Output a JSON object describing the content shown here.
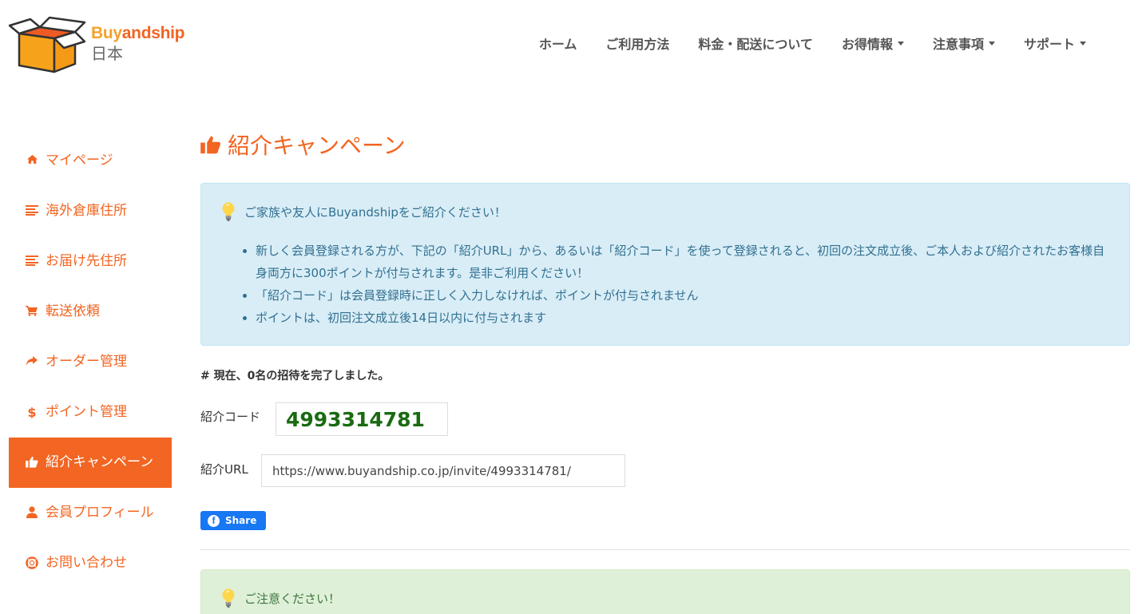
{
  "brand": {
    "name_part1": "Buy",
    "name_part2": "andship",
    "region": "日本",
    "accent_color": "#f26522"
  },
  "topnav": [
    {
      "label": "ホーム",
      "has_dropdown": false
    },
    {
      "label": "ご利用方法",
      "has_dropdown": false
    },
    {
      "label": "料金・配送について",
      "has_dropdown": false
    },
    {
      "label": "お得情報",
      "has_dropdown": true
    },
    {
      "label": "注意事項",
      "has_dropdown": true
    },
    {
      "label": "サポート",
      "has_dropdown": true
    }
  ],
  "sidebar": {
    "items": [
      {
        "label": "マイページ",
        "icon": "home-icon"
      },
      {
        "label": "海外倉庫住所",
        "icon": "list-icon"
      },
      {
        "label": "お届け先住所",
        "icon": "list-icon"
      },
      {
        "label": "転送依頼",
        "icon": "cart-icon"
      },
      {
        "label": "オーダー管理",
        "icon": "share-arrow-icon"
      },
      {
        "label": "ポイント管理",
        "icon": "dollar-icon"
      },
      {
        "label": "紹介キャンペーン",
        "icon": "thumbs-up-icon",
        "active": true
      },
      {
        "label": "会員プロフィール",
        "icon": "user-icon"
      },
      {
        "label": "お問い合わせ",
        "icon": "lifebuoy-icon"
      }
    ]
  },
  "main": {
    "title": "紹介キャンペーン",
    "info": {
      "heading": "ご家族や友人にBuyandshipをご紹介ください！",
      "bullets": [
        "新しく会員登録される方が、下記の「紹介URL」から、あるいは「紹介コード」を使って登録されると、初回の注文成立後、ご本人および紹介されたお客様自身両方に300ポイントが付与されます。是非ご利用ください！",
        "「紹介コード」は会員登録時に正しく入力しなければ、ポイントが付与されません",
        "ポイントは、初回注文成立後14日以内に付与されます"
      ]
    },
    "invite_count_text": "# 現在、0名の招待を完了しました。",
    "code_label": "紹介コード",
    "code_value": "4993314781",
    "url_label": "紹介URL",
    "url_value": "https://www.buyandship.co.jp/invite/4993314781/",
    "share_label": "Share",
    "warning_heading": "ご注意ください！"
  }
}
